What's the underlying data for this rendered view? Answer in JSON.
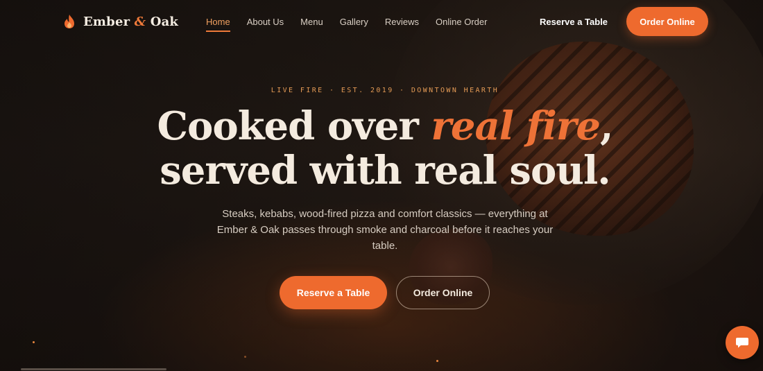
{
  "brand": {
    "name_part1": "Ember",
    "amp": "&",
    "name_part2": "Oak"
  },
  "nav": {
    "links": [
      "Home",
      "About Us",
      "Menu",
      "Gallery",
      "Reviews",
      "Online Order"
    ],
    "active": "Home",
    "reserve_label": "Reserve a Table",
    "order_label": "Order Online"
  },
  "hero": {
    "eyebrow": "LIVE FIRE · EST. 2019 · DOWNTOWN HEARTH",
    "headline_part1": "Cooked over ",
    "headline_highlight": "real fire",
    "headline_part2": ",",
    "headline_line2": "served with real soul.",
    "subtext": "Steaks, kebabs, wood-fired pizza and comfort classics — everything at Ember & Oak passes through smoke and charcoal before it reaches your table.",
    "primary_button": "Reserve a Table",
    "secondary_button": "Order Online"
  },
  "icons": {
    "logo": "flame-icon",
    "chat": "chat-bubble-icon"
  },
  "colors": {
    "accent": "#ee6a2e",
    "background": "#1a1411",
    "text": "#f4ebdf",
    "eyebrow": "#e39a55"
  }
}
